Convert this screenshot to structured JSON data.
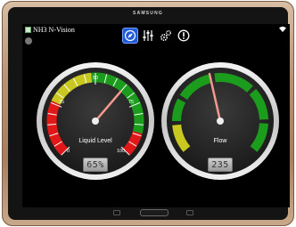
{
  "device": {
    "brand": "SAMSUNG"
  },
  "app": {
    "title": "NH3 N-Vision"
  },
  "toolbar": {
    "items": [
      {
        "name": "compass",
        "active": true
      },
      {
        "name": "sliders",
        "active": false
      },
      {
        "name": "settings",
        "active": false
      },
      {
        "name": "info",
        "active": false
      }
    ]
  },
  "gauges": {
    "liquid": {
      "label": "Liquid Level",
      "readout": "65%",
      "value_percent": 65,
      "ticks": [
        "0",
        "25",
        "50",
        "75",
        "100"
      ]
    },
    "flow": {
      "label": "Flow",
      "readout": "235"
    }
  },
  "colors": {
    "red": "#e01818",
    "yellow": "#c8c820",
    "green": "#1c9c1c",
    "needle": "#f29a8c",
    "toolbar_active": "#1f5bd8"
  }
}
